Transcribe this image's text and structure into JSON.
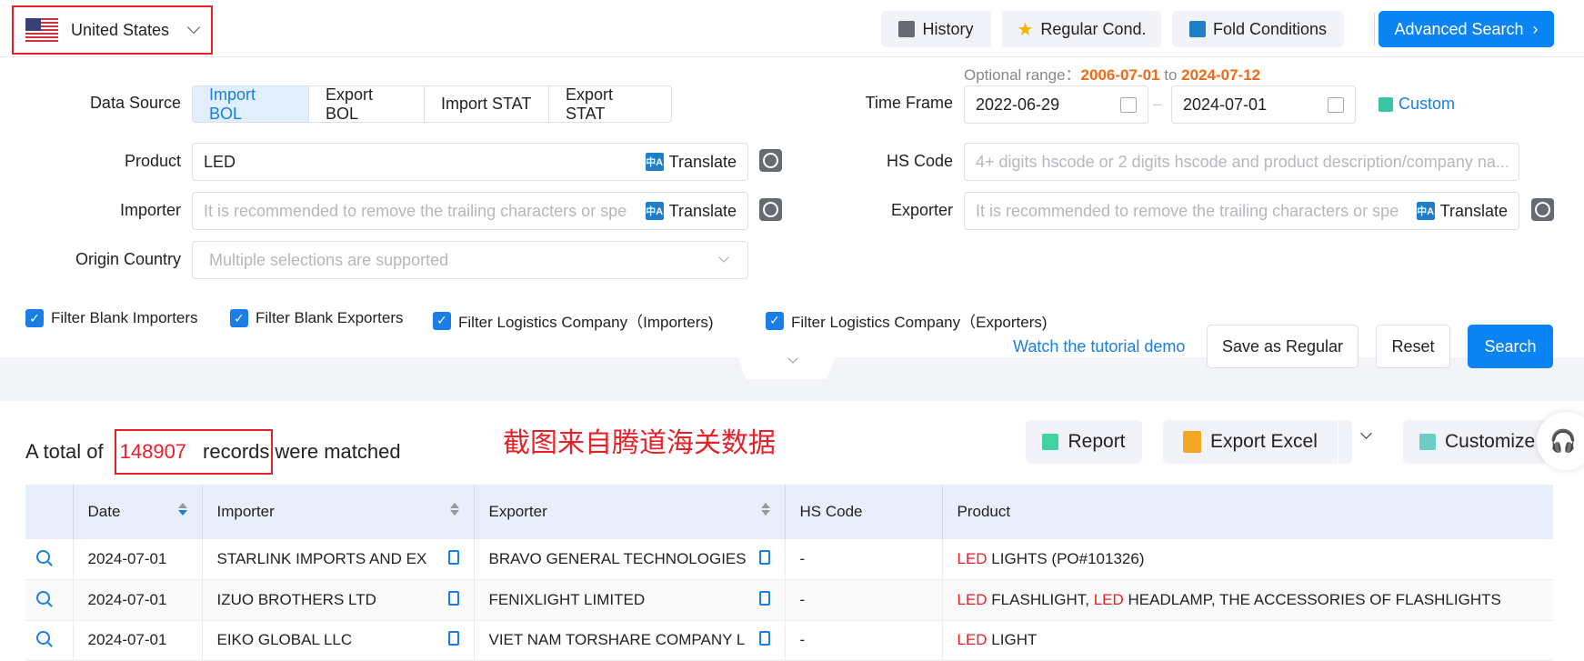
{
  "header": {
    "country": "United States",
    "history": "History",
    "regular": "Regular Cond.",
    "fold": "Fold Conditions",
    "advanced": "Advanced Search"
  },
  "form": {
    "data_source_label": "Data Source",
    "sources": [
      "Import BOL",
      "Export BOL",
      "Import STAT",
      "Export STAT"
    ],
    "optional_prefix": "Optional range：",
    "optional_start": "2006-07-01",
    "optional_to": "to",
    "optional_end": "2024-07-12",
    "time_frame_label": "Time Frame",
    "date_start": "2022-06-29",
    "date_end": "2024-07-01",
    "custom": "Custom",
    "product_label": "Product",
    "product_value": "LED",
    "translate": "Translate",
    "hs_label": "HS Code",
    "hs_placeholder": "4+ digits hscode or 2 digits hscode and product description/company na...",
    "importer_label": "Importer",
    "importer_placeholder": "It is recommended to remove the trailing characters or spe",
    "exporter_label": "Exporter",
    "exporter_placeholder": "It is recommended to remove the trailing characters or spe",
    "origin_label": "Origin Country",
    "origin_placeholder": "Multiple selections are supported",
    "filters": [
      "Filter Blank Importers",
      "Filter Blank Exporters",
      "Filter Logistics Company（Importers)",
      "Filter Logistics Company（Exporters)"
    ],
    "tutorial": "Watch the tutorial demo",
    "save": "Save as Regular",
    "reset": "Reset",
    "search": "Search"
  },
  "results": {
    "prefix": "A total of",
    "count": "148907",
    "records": "records",
    "suffix": "were matched",
    "watermark": "截图来自腾道海关数据",
    "report": "Report",
    "export": "Export Excel",
    "customize": "Customize"
  },
  "table": {
    "headers": [
      "Date",
      "Importer",
      "Exporter",
      "HS Code",
      "Product"
    ],
    "rows": [
      {
        "date": "2024-07-01",
        "importer": "STARLINK IMPORTS AND EX",
        "exporter": "BRAVO GENERAL TECHNOLOGIES",
        "hs": "-",
        "p_hl": "LED",
        "p1": " LIGHTS (PO#101326)",
        "p_hl2": "",
        "p2": ""
      },
      {
        "date": "2024-07-01",
        "importer": "IZUO BROTHERS LTD",
        "exporter": "FENIXLIGHT LIMITED",
        "hs": "-",
        "p_hl": "LED",
        "p1": " FLASHLIGHT, ",
        "p_hl2": "LED",
        "p2": " HEADLAMP, THE ACCESSORIES OF FLASHLIGHTS"
      },
      {
        "date": "2024-07-01",
        "importer": "EIKO GLOBAL LLC",
        "exporter": "VIET NAM TORSHARE COMPANY L",
        "hs": "-",
        "p_hl": "LED",
        "p1": " LIGHT",
        "p_hl2": "",
        "p2": ""
      }
    ]
  }
}
